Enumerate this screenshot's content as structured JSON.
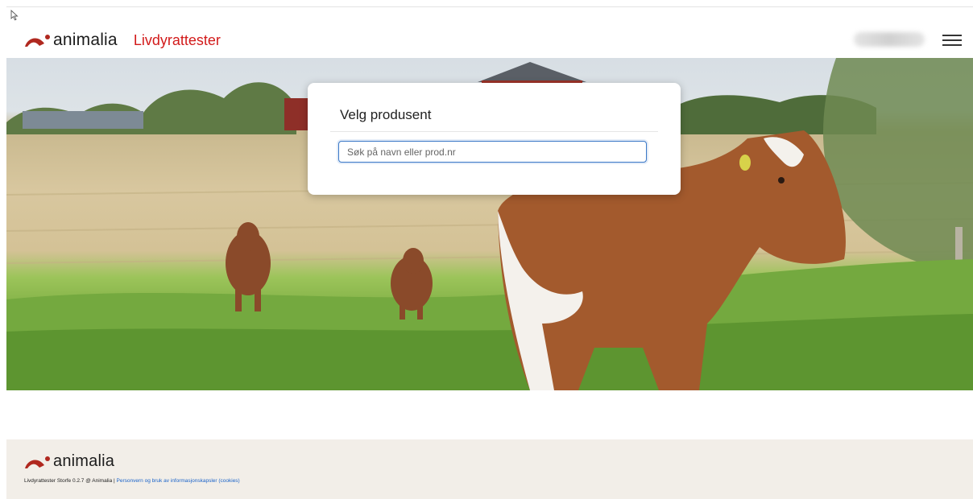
{
  "header": {
    "brand": "animalia",
    "app_title": "Livdyrattester",
    "menu_icon": "hamburger-menu-icon",
    "brand_color": "#d21a1a"
  },
  "card": {
    "title": "Velg produsent",
    "search": {
      "placeholder": "Søk på navn eller prod.nr",
      "value": ""
    }
  },
  "footer": {
    "brand": "animalia",
    "version_text": "Livdyrattester Storfe 0.2.7 @ Animalia",
    "separator": "|",
    "privacy_link": "Personvern og bruk av informasjonskapsler (cookies)"
  }
}
